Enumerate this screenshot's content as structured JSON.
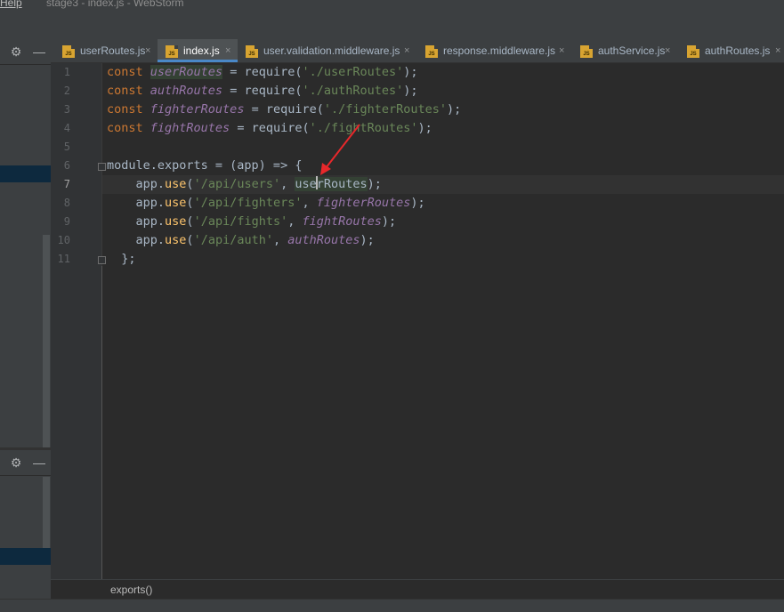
{
  "window": {
    "menu_help": "Help",
    "title": "stage3 - index.js - WebStorm"
  },
  "left_panel": {
    "settings_icon": "gear-icon",
    "hide_icon": "minus-icon"
  },
  "tabs": [
    {
      "label": "userRoutes.js"
    },
    {
      "label": "index.js",
      "active": true
    },
    {
      "label": "user.validation.middleware.js"
    },
    {
      "label": "response.middleware.js"
    },
    {
      "label": "authService.js"
    },
    {
      "label": "authRoutes.js"
    }
  ],
  "file_icon_label": "JS",
  "close_glyph": "×",
  "editor": {
    "line_numbers": [
      "1",
      "2",
      "3",
      "4",
      "5",
      "6",
      "7",
      "8",
      "9",
      "10",
      "11"
    ],
    "current_line": "7",
    "tokens": {
      "const": "const",
      "eq_require": " = require(",
      "close_semi": ");",
      "semi": ";",
      "userRoutes": "userRoutes",
      "userRoutes_head": "use",
      "userRoutes_tail": "rRoutes",
      "authRoutes": "authRoutes",
      "fighterRoutes": "fighterRoutes",
      "fightRoutes": "fightRoutes",
      "s_userRoutes": "'./userRoutes'",
      "s_authRoutes": "'./authRoutes'",
      "s_fighterRoutes": "'./fighterRoutes'",
      "s_fightRoutes": "'./fightRoutes'",
      "module_exports": "module.exports = (app) => {",
      "app_dot": "app.",
      "use": "use",
      "paren": "(",
      "comma": ", ",
      "s_api_users": "'/api/users'",
      "s_api_fighters": "'/api/fighters'",
      "s_api_fights": "'/api/fights'",
      "s_api_auth": "'/api/auth'",
      "closing": "};"
    }
  },
  "annotation_color": "#e8282b",
  "breadcrumb": {
    "label": "exports()"
  }
}
